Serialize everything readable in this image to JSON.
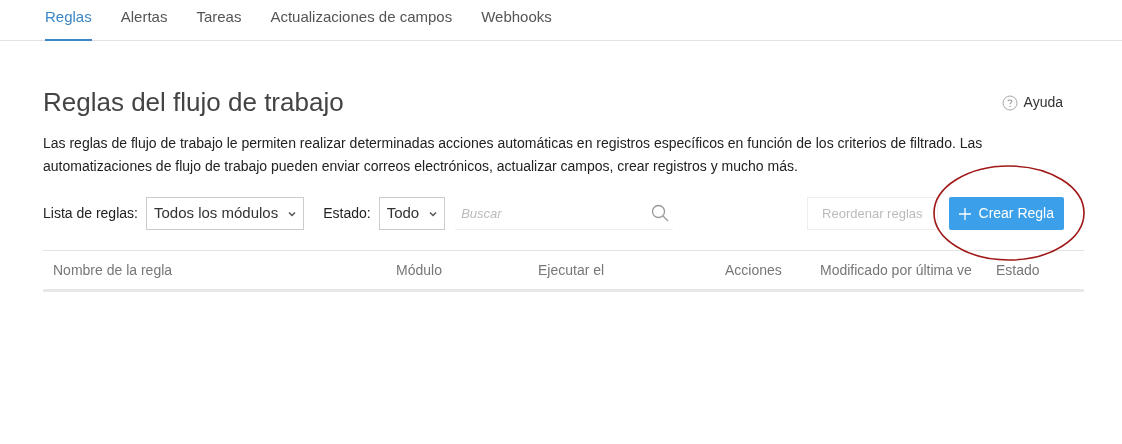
{
  "tabs": [
    {
      "label": "Reglas",
      "selected": true
    },
    {
      "label": "Alertas",
      "selected": false
    },
    {
      "label": "Tareas",
      "selected": false
    },
    {
      "label": "Actualizaciones de campos",
      "selected": false
    },
    {
      "label": "Webhooks",
      "selected": false
    }
  ],
  "title": "Reglas del flujo de trabajo",
  "help": "Ayuda",
  "description": "Las reglas de flujo de trabajo le permiten realizar determinadas acciones automáticas en registros específicos en función de los criterios de filtrado. Las automatizaciones de flujo de trabajo pueden enviar correos electrónicos, actualizar campos, crear registros y mucho más.",
  "filters": [
    {
      "label": "Lista de reglas:",
      "value": "Todos los módulos"
    },
    {
      "label": "Estado:",
      "value": "Todo"
    }
  ],
  "search": {
    "placeholder": "Buscar"
  },
  "reorder_button": {
    "label": "Reordenar reglas",
    "disabled": true
  },
  "create_button": {
    "label": "Crear Regla"
  },
  "table": {
    "columns": [
      "Nombre de la regla",
      "Módulo",
      "Ejecutar el",
      "Acciones",
      "Modificado por última ve",
      "Estado"
    ]
  }
}
